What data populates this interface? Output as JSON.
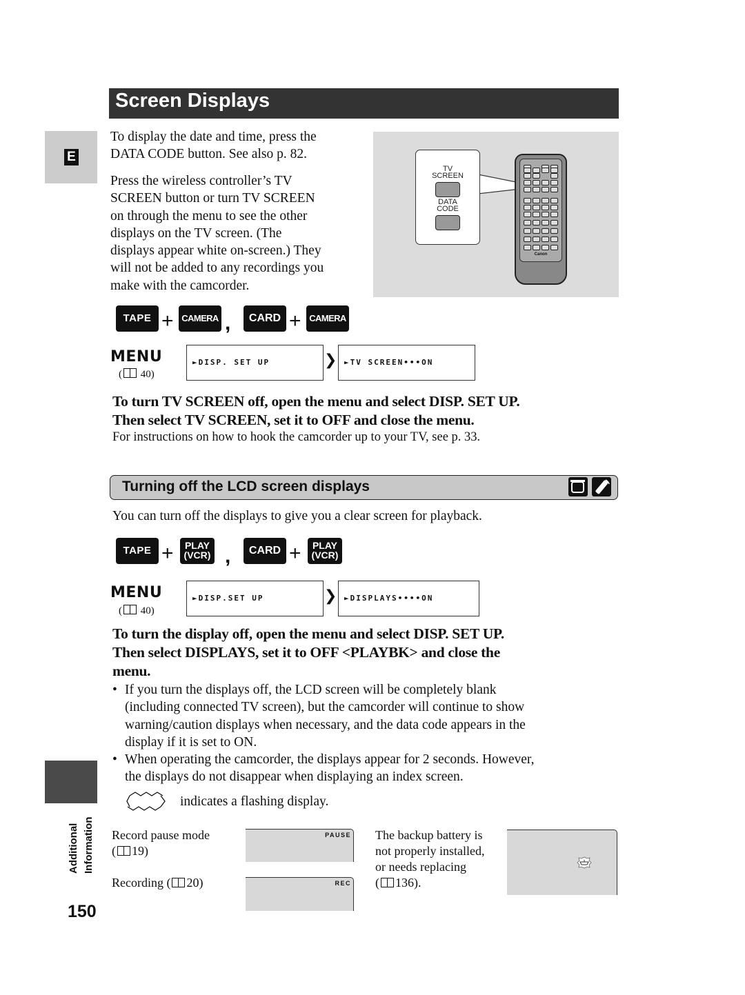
{
  "header": {
    "title": "Screen Displays",
    "language_tab": "E"
  },
  "intro": {
    "date_time_text": [
      "To display the date and time, press the",
      "DATA CODE button. See also p. 82."
    ],
    "tv_screen_text": [
      "Press the wireless controller’s TV",
      "SCREEN button or turn TV SCREEN",
      "on through the menu to see the other",
      "displays on the TV screen. (The",
      "displays appear white on-screen.) They",
      "will not be added to any recordings you",
      "make with the camcorder."
    ]
  },
  "remote_illustration": {
    "tv_screen_label": [
      "TV",
      "SCREEN"
    ],
    "data_code_label": [
      "DATA",
      "CODE"
    ],
    "brand": "Canon"
  },
  "section1": {
    "modes": {
      "tape": "TAPE",
      "camera": "CAMERA",
      "card": "CARD",
      "plus": "+",
      "comma": ","
    },
    "menu_label": "MENU",
    "menu_ref_page": "40",
    "menu_step1": "►DISP. SET UP",
    "menu_step2": "►TV SCREEN•••ON",
    "next_arrow": "❯",
    "instruction": [
      "To turn TV SCREEN off, open the menu and select DISP. SET UP.",
      "Then select TV SCREEN, set it to OFF and close the menu."
    ],
    "note": "For instructions on how to hook the camcorder up to your TV, see p. 33."
  },
  "section2": {
    "title": "Turning off the LCD screen displays",
    "icons": [
      "camcorder-lcd-icon",
      "remote-control-icon"
    ],
    "intro": "You can turn off the displays to give you a clear screen for playback.",
    "modes": {
      "tape": "TAPE",
      "play_line1": "PLAY",
      "play_line2": "(VCR)",
      "card": "CARD",
      "plus": "+",
      "comma": ","
    },
    "menu_label": "MENU",
    "menu_ref_page": "40",
    "menu_step1": "►DISP.SET UP",
    "menu_step2": "►DISPLAYS••••ON",
    "next_arrow": "❯",
    "instruction": [
      "To turn the display off, open the menu and select DISP. SET UP.",
      "Then select DISPLAYS, set it to OFF <PLAYBK> and close the",
      "menu."
    ],
    "bullets": [
      {
        "lines": [
          "If you turn the displays off, the LCD screen will be completely blank",
          "(including connected TV screen), but the camcorder will continue to show",
          "warning/caution displays when necessary, and the data code appears in the",
          "display if it is set to ON."
        ]
      },
      {
        "lines": [
          "When operating the camcorder, the displays appear for 2 seconds. However,",
          "the displays do not disappear when displaying an index screen."
        ]
      }
    ],
    "flash_note": "indicates a flashing display."
  },
  "examples": [
    {
      "label_lines": [
        "Record pause mode",
        "19)"
      ],
      "screen_text": "PAUSE"
    },
    {
      "label_lines": [
        "Recording (",
        "20)"
      ],
      "screen_text": "REC"
    },
    {
      "label_lines": [
        "The backup battery is",
        "not properly installed,",
        "or needs replacing",
        "136)."
      ],
      "screen_text": ""
    }
  ],
  "sidebar": {
    "section_label_line1": "Additional",
    "section_label_line2": "Information",
    "page_number": "150"
  }
}
